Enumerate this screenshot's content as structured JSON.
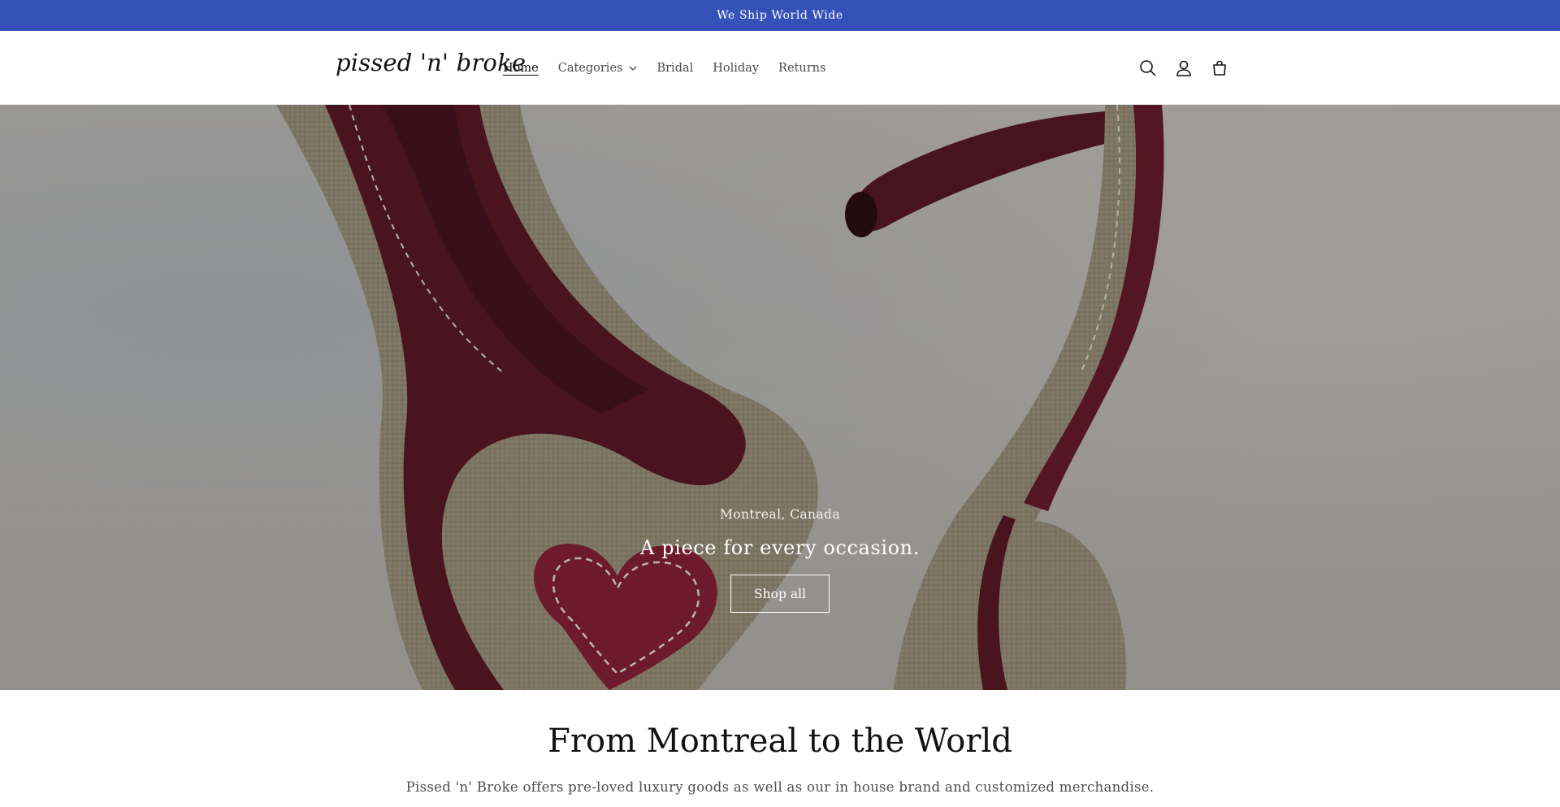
{
  "announcement": {
    "text": "We Ship World Wide"
  },
  "header": {
    "logo": "pissed 'n' broke",
    "nav": [
      {
        "label": "Home",
        "active": true
      },
      {
        "label": "Categories",
        "has_dropdown": true
      },
      {
        "label": "Bridal"
      },
      {
        "label": "Holiday"
      },
      {
        "label": "Returns"
      }
    ],
    "icons": [
      "search-icon",
      "account-icon",
      "cart-icon"
    ]
  },
  "hero": {
    "subheading": "Montreal, Canada",
    "heading": "A piece for every occasion.",
    "button_label": "Shop all"
  },
  "intro": {
    "title": "From Montreal to the World",
    "text": "Pissed 'n' Broke offers pre-loved luxury goods as well as our in house brand and customized merchandise."
  },
  "colors": {
    "announcement_bg": "#3451b8",
    "text": "#121212",
    "accent_burgundy": "#7a1c2e"
  }
}
